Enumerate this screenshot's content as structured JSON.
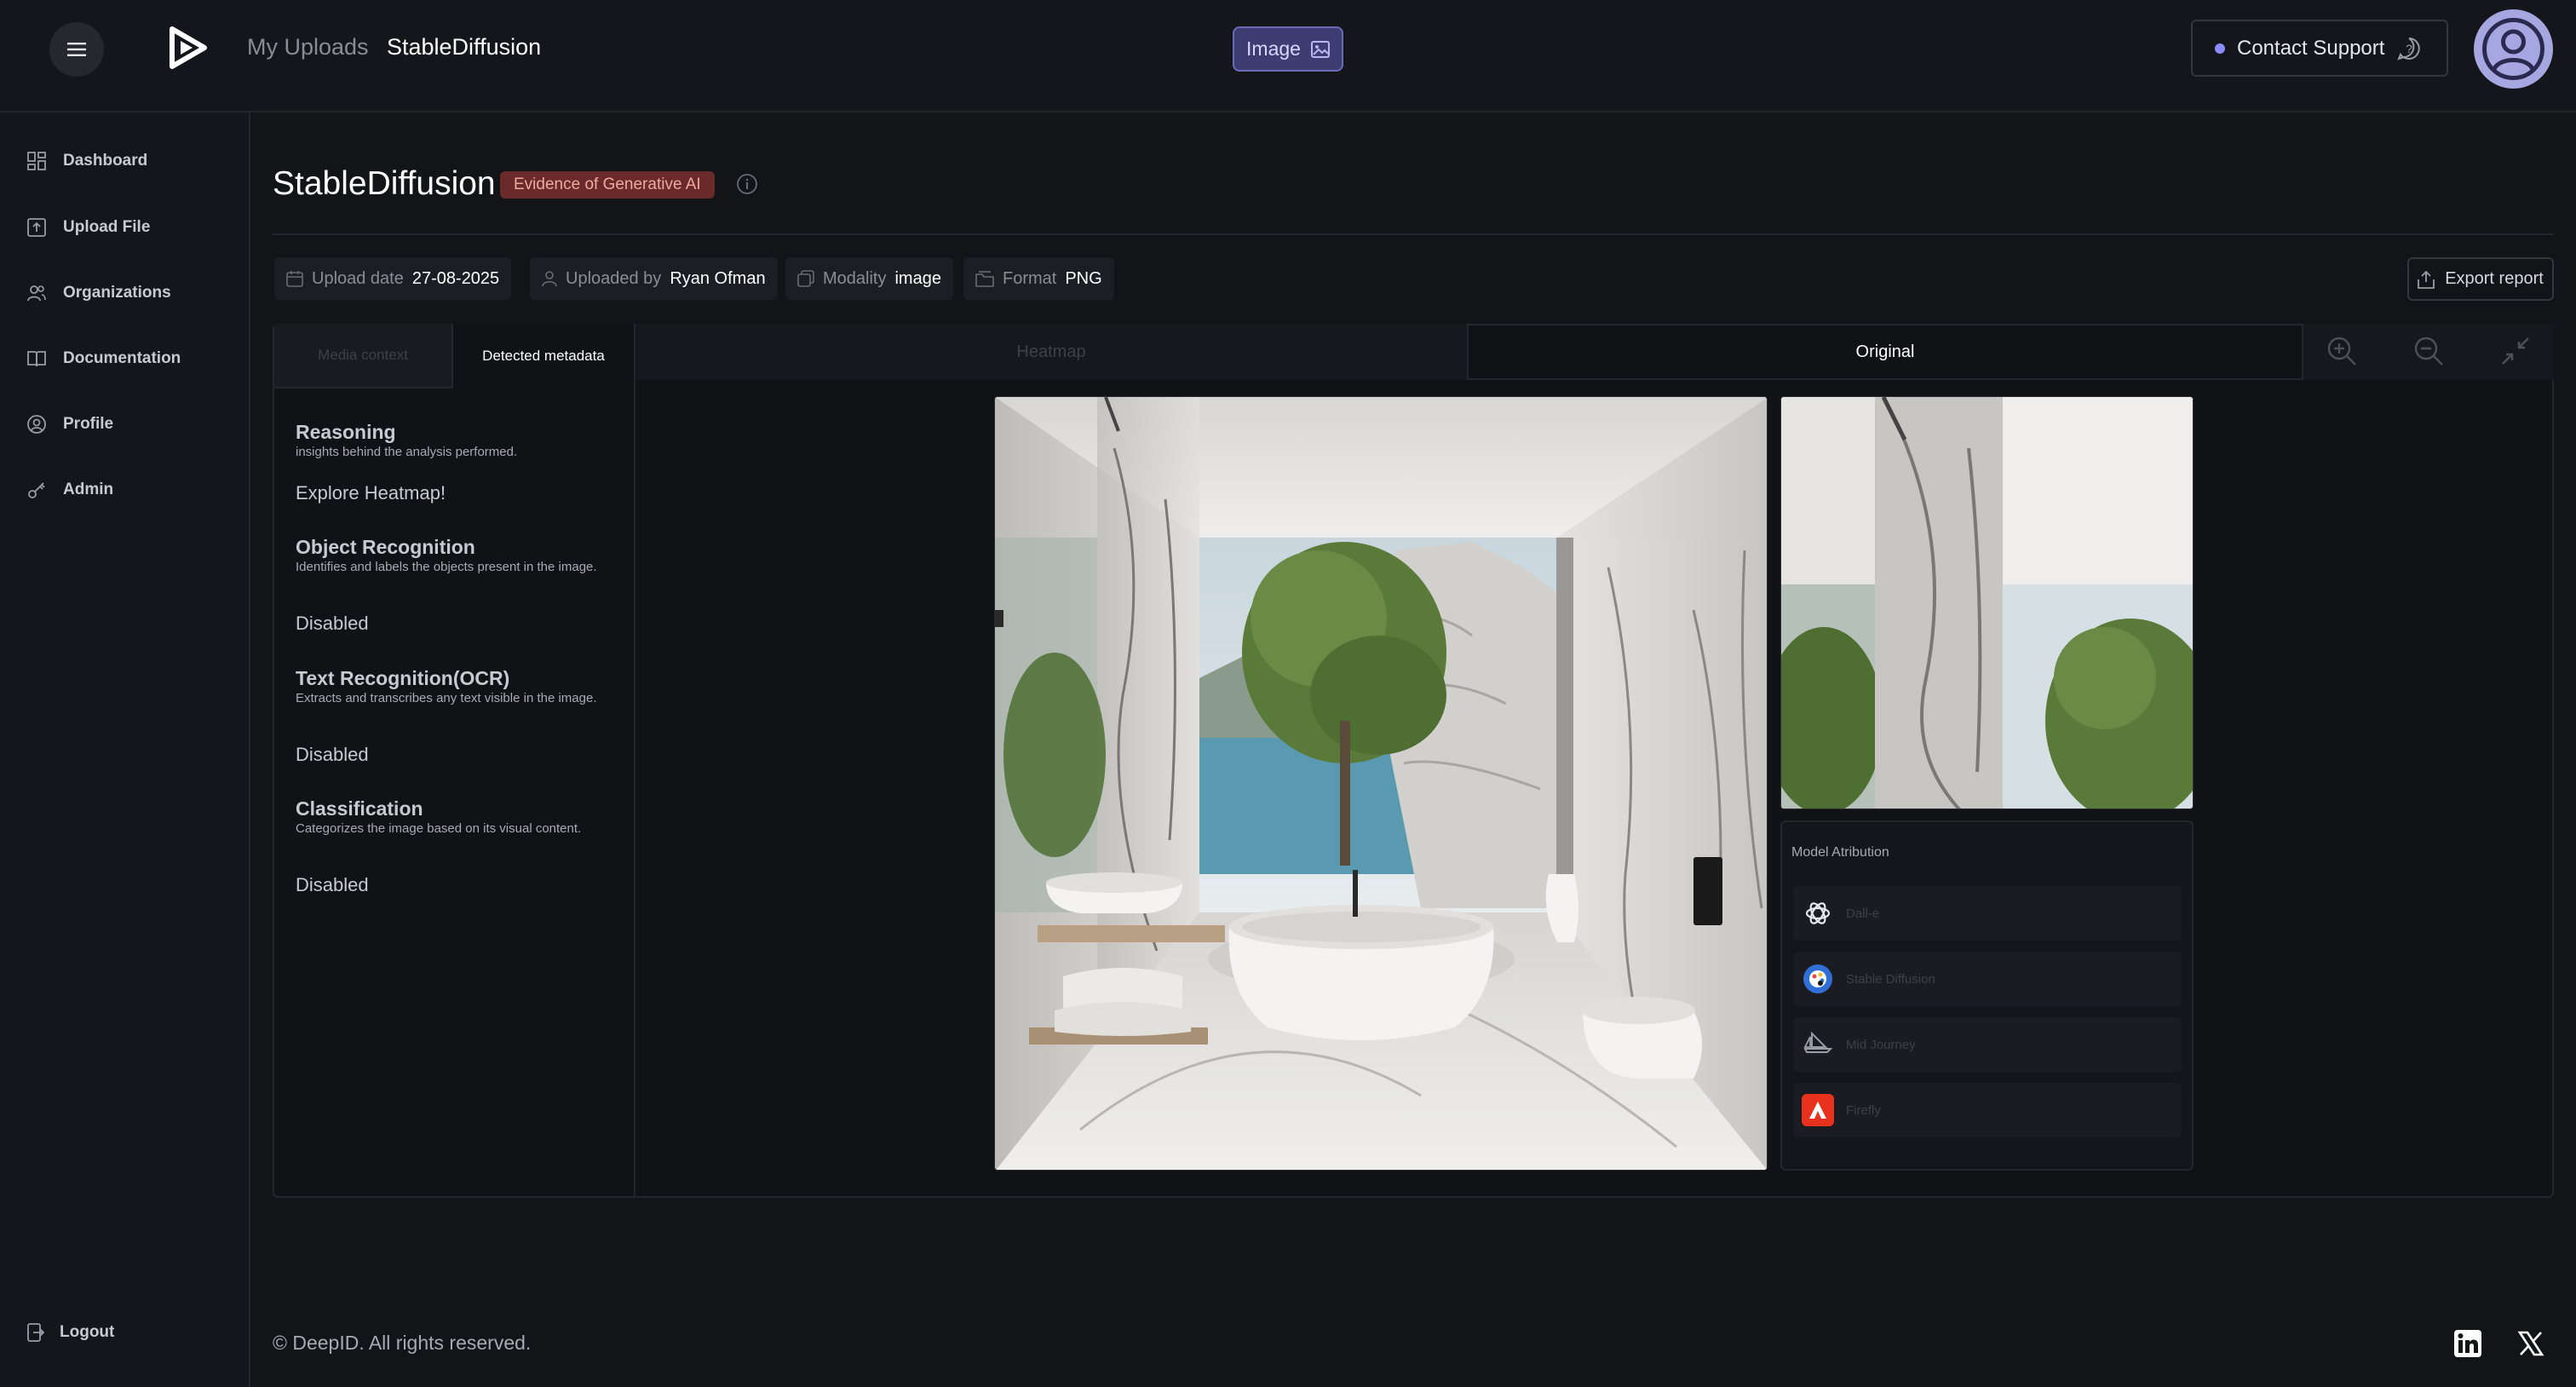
{
  "header": {
    "breadcrumb": [
      "My Uploads",
      "StableDiffusion"
    ],
    "mode_label": "Image",
    "support_label": "Contact Support"
  },
  "sidebar": {
    "items": [
      {
        "label": "Dashboard",
        "icon": "dashboard-icon"
      },
      {
        "label": "Upload File",
        "icon": "upload-icon"
      },
      {
        "label": "Organizations",
        "icon": "users-icon"
      },
      {
        "label": "Documentation",
        "icon": "book-icon"
      },
      {
        "label": "Profile",
        "icon": "profile-icon"
      },
      {
        "label": "Admin",
        "icon": "key-icon"
      }
    ],
    "logout_label": "Logout"
  },
  "page": {
    "title": "StableDiffusion",
    "badge": "Evidence of Generative AI",
    "meta": {
      "upload_date_label": "Upload date",
      "upload_date": "27-08-2025",
      "uploaded_by_label": "Uploaded by",
      "uploaded_by": "Ryan Ofman",
      "modality_label": "Modality",
      "modality": "image",
      "format_label": "Format",
      "format": "PNG"
    },
    "export_label": "Export report"
  },
  "left_panel": {
    "tabs": [
      "Media context",
      "Detected metadata"
    ],
    "active_tab": "Detected metadata",
    "sections": [
      {
        "title": "Reasoning",
        "desc": "insights behind the analysis performed.",
        "value": "Explore Heatmap!"
      },
      {
        "title": "Object Recognition",
        "desc": "Identifies and labels the objects present in the image.",
        "value": "Disabled"
      },
      {
        "title": "Text Recognition(OCR)",
        "desc": "Extracts and transcribes any text visible in the image.",
        "value": "Disabled"
      },
      {
        "title": "Classification",
        "desc": "Categorizes the image based on its visual content.",
        "value": "Disabled"
      }
    ]
  },
  "viewer": {
    "tabs": [
      "Heatmap",
      "Original"
    ],
    "active_tab": "Original",
    "model_attribution": {
      "title": "Model Atribution",
      "models": [
        "Dall-e",
        "Stable Diffusion",
        "Mid Journey",
        "Firefly"
      ]
    }
  },
  "footer": {
    "copyright": "© DeepID. All rights reserved.",
    "social": [
      "linkedin-icon",
      "x-icon"
    ]
  },
  "colors": {
    "background": "#131418",
    "accent": "#6a6ab8",
    "badge_bg": "#6a2a2a",
    "badge_text": "#f0a8a0",
    "firefly_red": "#e8321e",
    "stable_diffusion_blue": "#2f6fd6"
  }
}
